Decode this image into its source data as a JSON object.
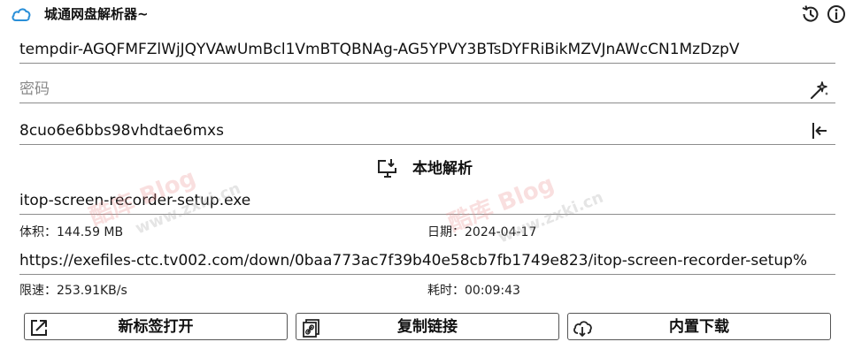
{
  "app": {
    "title": "城通网盘解析器~"
  },
  "inputs": {
    "share_url": "tempdir-AGQFMFZlWjJQYVAwUmBcl1VmBTQBNAg-AG5YPVY3BTsDYFRiBikMZVJnAWcCN1MzDzpV",
    "password_placeholder": "密码",
    "password_value": "",
    "code_value": "8cuo6e6bbs98vhdtae6mxs"
  },
  "parse": {
    "label": "本地解析"
  },
  "result": {
    "filename": "itop-screen-recorder-setup.exe",
    "size_label": "体积：",
    "size": "144.59 MB",
    "date_label": "日期：",
    "date": "2024-04-17",
    "download_url": "https://exefiles-ctc.tv002.com/down/0baa773ac7f39b40e58cb7fb1749e823/itop-screen-recorder-setup%",
    "speed_label": "限速：",
    "speed": "253.91KB/s",
    "time_label": "耗时：",
    "time": "00:09:43"
  },
  "buttons": {
    "open_tab": "新标签打开",
    "copy_link": "复制链接",
    "builtin_download": "内置下载"
  },
  "watermark": {
    "main": "酷库 Blog",
    "sub": "www.zxki.cn"
  },
  "colors": {
    "accent": "#2a8fd8",
    "border": "#555555"
  }
}
